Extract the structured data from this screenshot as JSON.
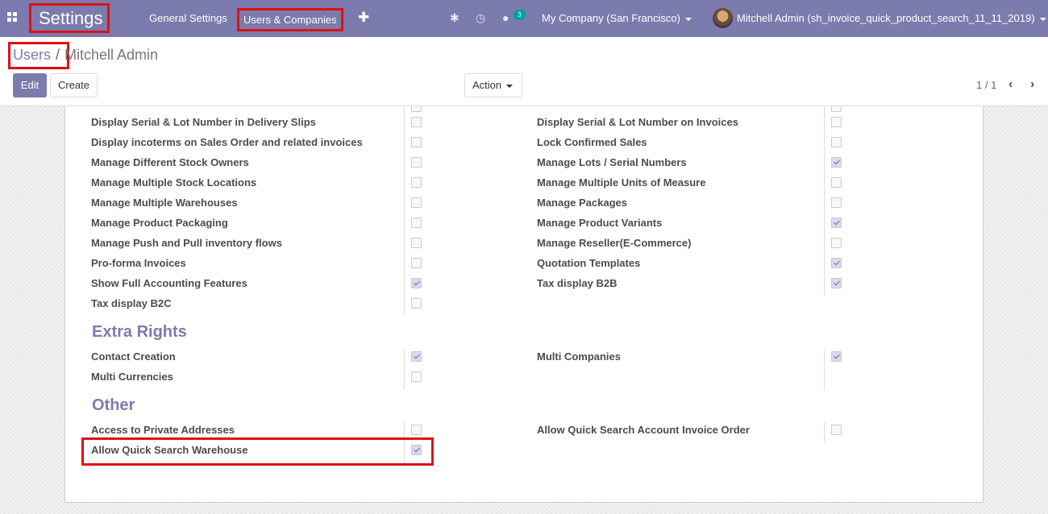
{
  "navbar": {
    "brand": "Settings",
    "menu_general": "General Settings",
    "menu_users_companies": "Users & Companies",
    "plus_icon": "plus-icon",
    "bug_icon": "bug-icon",
    "clock_icon": "clock-icon",
    "chat_icon": "chat-icon",
    "chat_badge": "3",
    "company": "My Company (San Francisco)",
    "user": "Mitchell Admin (sh_invoice_quick_product_search_11_11_2019)",
    "accent_color": "#7c7bad"
  },
  "breadcrumb": {
    "parent": "Users",
    "separator": "/",
    "current": "Mitchell Admin"
  },
  "buttons": {
    "edit": "Edit",
    "create": "Create",
    "action": "Action"
  },
  "pager": {
    "value": "1 / 1"
  },
  "technical_left": [
    {
      "label": "Display Serial & Lot Number in Delivery Slips",
      "checked": false
    },
    {
      "label": "Display incoterms on Sales Order and related invoices",
      "checked": false
    },
    {
      "label": "Manage Different Stock Owners",
      "checked": false
    },
    {
      "label": "Manage Multiple Stock Locations",
      "checked": false
    },
    {
      "label": "Manage Multiple Warehouses",
      "checked": false
    },
    {
      "label": "Manage Product Packaging",
      "checked": false
    },
    {
      "label": "Manage Push and Pull inventory flows",
      "checked": false
    },
    {
      "label": "Pro-forma Invoices",
      "checked": false
    },
    {
      "label": "Show Full Accounting Features",
      "checked": true
    },
    {
      "label": "Tax display B2C",
      "checked": false
    }
  ],
  "technical_right": [
    {
      "label": "Display Serial & Lot Number on Invoices",
      "checked": false
    },
    {
      "label": "Lock Confirmed Sales",
      "checked": false
    },
    {
      "label": "Manage Lots / Serial Numbers",
      "checked": true
    },
    {
      "label": "Manage Multiple Units of Measure",
      "checked": false
    },
    {
      "label": "Manage Packages",
      "checked": false
    },
    {
      "label": "Manage Product Variants",
      "checked": true
    },
    {
      "label": "Manage Reseller(E-Commerce)",
      "checked": false
    },
    {
      "label": "Quotation Templates",
      "checked": true
    },
    {
      "label": "Tax display B2B",
      "checked": true
    }
  ],
  "extra_rights": {
    "title": "Extra Rights",
    "left": [
      {
        "label": "Contact Creation",
        "checked": true
      },
      {
        "label": "Multi Currencies",
        "checked": false
      }
    ],
    "right": [
      {
        "label": "Multi Companies",
        "checked": true
      }
    ]
  },
  "other": {
    "title": "Other",
    "left": [
      {
        "label": "Access to Private Addresses",
        "checked": false
      },
      {
        "label": "Allow Quick Search Warehouse",
        "checked": true
      }
    ],
    "right": [
      {
        "label": "Allow Quick Search Account Invoice Order",
        "checked": false
      }
    ]
  }
}
